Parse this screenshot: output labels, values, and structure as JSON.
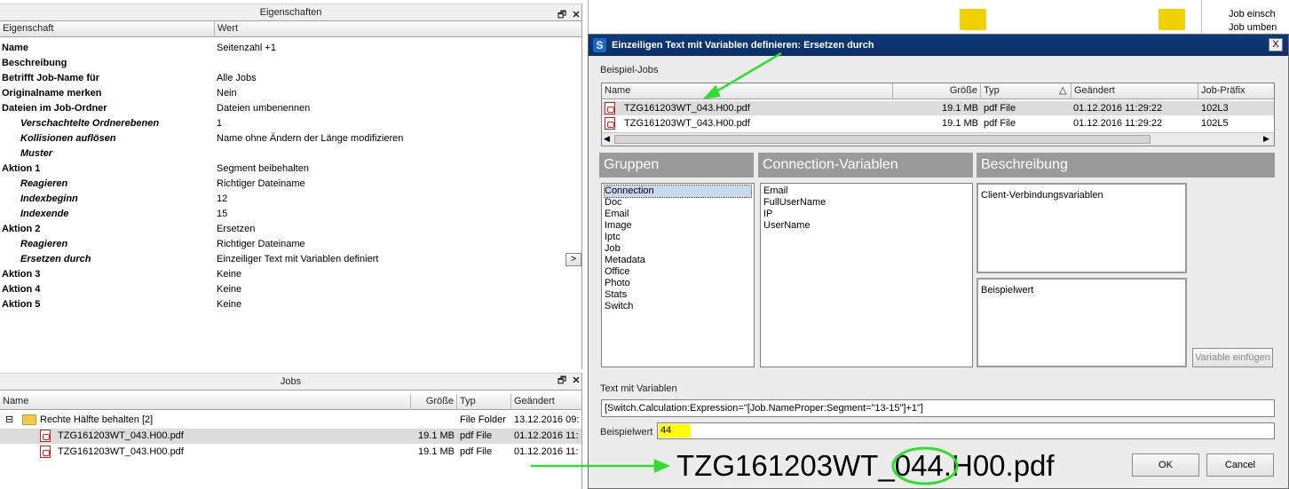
{
  "properties_panel": {
    "title": "Eigenschaften",
    "restore_icon": "🗗",
    "close_icon": "✕",
    "col_property": "Eigenschaft",
    "col_value": "Wert",
    "rows": [
      {
        "key": "Name",
        "value": "Seitenzahl +1",
        "indent": 0
      },
      {
        "key": "Beschreibung",
        "value": "",
        "indent": 0
      },
      {
        "key": "Betrifft Job-Name für",
        "value": "Alle Jobs",
        "indent": 0
      },
      {
        "key": "Originalname merken",
        "value": "Nein",
        "indent": 0
      },
      {
        "key": "Dateien im Job-Ordner",
        "value": "Dateien umbenennen",
        "indent": 0
      },
      {
        "key": "Verschachtelte Ordnerebenen",
        "value": "1",
        "indent": 1
      },
      {
        "key": "Kollisionen auflösen",
        "value": "Name ohne Ändern der Länge modifizieren",
        "indent": 1
      },
      {
        "key": "Muster",
        "value": "",
        "indent": 1
      },
      {
        "key": "Aktion 1",
        "value": "Segment beibehalten",
        "indent": 0
      },
      {
        "key": "Reagieren",
        "value": "Richtiger Dateiname",
        "indent": 1
      },
      {
        "key": "Indexbeginn",
        "value": "12",
        "indent": 1
      },
      {
        "key": "Indexende",
        "value": "15",
        "indent": 1
      },
      {
        "key": "Aktion 2",
        "value": "Ersetzen",
        "indent": 0
      },
      {
        "key": "Reagieren",
        "value": "Richtiger Dateiname",
        "indent": 1
      },
      {
        "key": "Ersetzen durch",
        "value": "Einzeiliger Text mit Variablen definiert",
        "indent": 1
      },
      {
        "key": "Aktion 3",
        "value": "Keine",
        "indent": 0
      },
      {
        "key": "Aktion 4",
        "value": "Keine",
        "indent": 0
      },
      {
        "key": "Aktion 5",
        "value": "Keine",
        "indent": 0
      }
    ],
    "edit_button": ">"
  },
  "jobs_panel": {
    "title": "Jobs",
    "columns": [
      "Name",
      "Größe",
      "Typ",
      "Geändert"
    ],
    "folder": {
      "name": "Rechte Hälfte behalten [2]",
      "type": "File Folder",
      "changed": "13.12.2016 09:",
      "expander": "⊟"
    },
    "files": [
      {
        "name": "TZG161203WT_043.H00.pdf",
        "size": "19.1 MB",
        "type": "pdf File",
        "changed": "01.12.2016 11:"
      },
      {
        "name": "TZG161203WT_043.H00.pdf",
        "size": "19.1 MB",
        "type": "pdf File",
        "changed": "01.12.2016 11:"
      }
    ]
  },
  "background_right": {
    "items": [
      "Job einsch",
      "Job umben"
    ]
  },
  "dialog": {
    "title": "Einzeiligen Text mit Variablen definieren: Ersetzen durch",
    "app_icon_letter": "S",
    "close_label": "X",
    "example_jobs_label": "Beispiel-Jobs",
    "columns": [
      "Name",
      "Größe",
      "Typ",
      "Geändert",
      "Job-Präfix"
    ],
    "sort_indicator": "△",
    "rows": [
      {
        "name": "TZG161203WT_043.H00.pdf",
        "size": "19.1 MB",
        "type": "pdf File",
        "changed": "01.12.2016 11:29:22",
        "prefix": "102L3"
      },
      {
        "name": "TZG161203WT_043.H00.pdf",
        "size": "19.1 MB",
        "type": "pdf File",
        "changed": "01.12.2016 11:29:22",
        "prefix": "102L5"
      }
    ],
    "scroll_left": "◀",
    "scroll_right": "▶",
    "groups_header": "Gruppen",
    "variables_header": "Connection-Variablen",
    "description_header": "Beschreibung",
    "groups": [
      "Connection",
      "Doc",
      "Email",
      "Image",
      "Iptc",
      "Job",
      "Metadata",
      "Office",
      "Photo",
      "Stats",
      "Switch"
    ],
    "variables": [
      "Email",
      "FullUserName",
      "IP",
      "UserName"
    ],
    "description_text": "Client-Verbindungsvariablen",
    "example_value_box_label": "Beispielwert",
    "insert_variable_button": "Variable einfügen",
    "text_with_variables_label": "Text mit Variablen",
    "text_with_variables_value": "[Switch.Calculation:Expression=\"[Job.NameProper:Segment=\"13-15\"]+1\"]",
    "example_value_label": "Beispielwert",
    "example_value": "44",
    "ok_button": "OK",
    "cancel_button": "Cancel"
  },
  "annotation": {
    "result_filename": "TZG161203WT_044.H00.pdf",
    "arrow_color": "#2ee02e",
    "highlight_color": "#ffff00"
  }
}
